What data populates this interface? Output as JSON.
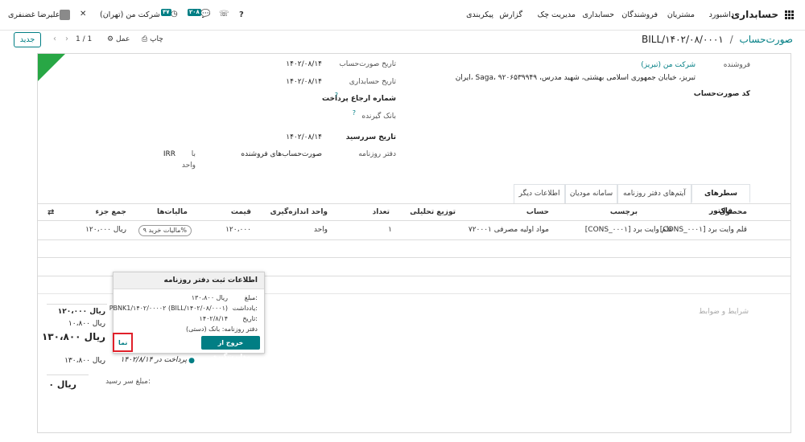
{
  "topbar": {
    "app_name": "حسابداری",
    "menu": [
      "داشبورد",
      "مشتریان",
      "فروشندگان",
      "حسابداری",
      "مدیریت چک",
      "گزارش",
      "پیکربندی"
    ],
    "company": "شرکت من (تهران)",
    "user": "علیرضا غضنفری",
    "badge_activity": "۴۷",
    "badge_messages": "۲۰۸"
  },
  "control": {
    "breadcrumb_parent": "صورت‌حساب",
    "breadcrumb_sep": "/",
    "breadcrumb_current": "BILL/۱۴۰۲/۰۸/۰۰۰۱",
    "print": "چاپ",
    "action": "عمل",
    "pager": "1 / 1",
    "new_button": "جدید"
  },
  "vendor": {
    "label": "فروشنده",
    "name": "شرکت من (تبریز)",
    "address_line1": "ایران، Saga، تبریز، خیابان جمهوری اسلامی بهشتی، شهید مدرس، ۹۲۰۶۵۳۹۹۴۹",
    "bill_ref_label": "کد صورت‌حساب"
  },
  "dates": {
    "bill_date_label": "تاریخ صورت‌حساب",
    "bill_date": "۱۴۰۲/۰۸/۱۴",
    "accounting_date_label": "تاریخ حسابداری",
    "accounting_date": "۱۴۰۲/۰۸/۱۴",
    "payment_ref_label": "شماره ارجاع پرداخت",
    "recipient_bank_label": "بانک گیرنده",
    "due_date_label": "تاریخ سررسید",
    "due_date": "۱۴۰۲/۰۸/۱۴",
    "journal_label": "دفتر روزنامه",
    "journal_value": "صورت‌حساب‌های فروشنده",
    "currency_in": "با",
    "currency": "IRR",
    "currency_unit": "واحد"
  },
  "tabs": [
    "سطرهای فاکتور",
    "آیتم‌های دفتر روزنامه",
    "سامانه مودیان",
    "اطلاعات دیگر"
  ],
  "table": {
    "headers": [
      "محصول",
      "برچسب",
      "حساب",
      "توزیع تحلیلی",
      "تعداد",
      "واحد اندازه‌گیری",
      "قیمت",
      "مالیات‌ها",
      "جمع جزء"
    ],
    "row": {
      "product": "[CONS_۰۰۰۱] قلم وایت برد",
      "label": "[CONS_۰۰۰۱] قلم وایت برد",
      "account": "۷۲۰۰۰۱ مواد اولیه مصرفی",
      "quantity": "۱",
      "uom": "واحد",
      "price": "۱۲۰،۰۰۰",
      "tax": "مالیات خرید ۹%",
      "subtotal": "۱۲۰،۰۰۰ ریال"
    }
  },
  "terms_placeholder": "شرایط و ضوابط",
  "totals": {
    "untaxed": "۱۲۰،۰۰۰ ریال",
    "tax": "۱۰،۸۰۰ ریال",
    "total": "۱۳۰،۸۰۰ ریال",
    "paid_on": "پرداخت در ۱۴۰۲/۸/۱۴",
    "paid_amount": "۱۳۰،۸۰۰ ریال",
    "due_label": "مبلغ سر رسید:",
    "due_amount": "۰ ریال"
  },
  "popup": {
    "title": "اطلاعات ثبت دفتر روزنامه",
    "amount_label": "مبلغ:",
    "amount": "۱۳۰،۸۰۰ ریال",
    "memo_label": "یادداشت:",
    "memo": "PBNK1/۱۴۰۲/۰۰۰۰۲ (BILL/۱۴۰۲/۰۸/۰۰۰۱)",
    "date_label": "تاریخ:",
    "date": "۱۴۰۲/۸/۱۴",
    "journal_line": "دفتر روزنامه: بانک (دستی)",
    "unreconcile": "خروج از مغایرت‌گیری",
    "view": "نما"
  },
  "colors": {
    "accent": "#017e84",
    "ribbon": "#28a745",
    "highlight": "#e0202a"
  }
}
